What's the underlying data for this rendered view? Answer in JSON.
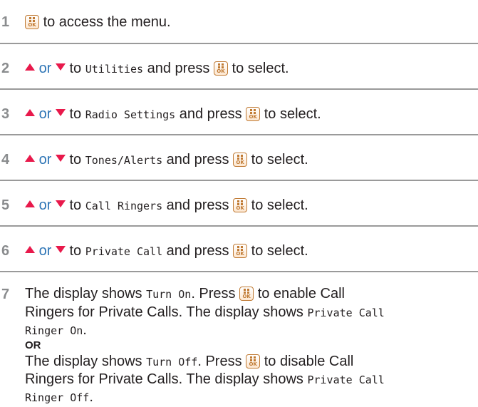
{
  "colors": {
    "step_number": "#8a8c8e",
    "or_text": "#2e75b6",
    "arrow": "#e8194b",
    "ok_button": "#c07a33",
    "separator": "#9a9a9a"
  },
  "icons": {
    "ok_button": "menu-ok-button-icon",
    "up": "up-arrow-icon",
    "down": "down-arrow-icon"
  },
  "common": {
    "or": "or",
    "to": "to",
    "and_press": "and press",
    "to_select": "to select."
  },
  "steps": [
    {
      "num": "1",
      "text": "to access the menu."
    },
    {
      "num": "2",
      "target": "Utilities"
    },
    {
      "num": "3",
      "target": "Radio Settings"
    },
    {
      "num": "4",
      "target": "Tones/Alerts"
    },
    {
      "num": "5",
      "target": "Call Ringers"
    },
    {
      "num": "6",
      "target": "Private Call"
    }
  ],
  "step7": {
    "num": "7",
    "a": {
      "t1": "The display shows",
      "disp1": "Turn On",
      "t2": ". Press",
      "t3": "to enable Call",
      "t4": "Ringers for Private Calls. The display shows",
      "disp2a": "Private Call",
      "disp2b": "Ringer On",
      "end": "."
    },
    "or": "OR",
    "b": {
      "t1": "The display shows",
      "disp1": "Turn Off",
      "t2": ". Press",
      "t3": "to disable Call",
      "t4": "Ringers for Private Calls. The display shows",
      "disp2a": "Private Call",
      "disp2b": "Ringer Off",
      "end": "."
    }
  }
}
